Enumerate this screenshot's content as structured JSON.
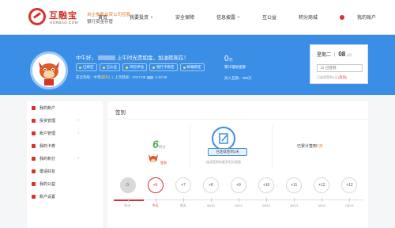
{
  "brand": {
    "name_cn": "互融宝",
    "name_en": "HURBAO.COM",
    "tagline1": "央企参股合资公司控股",
    "tagline2": "银行资金存管"
  },
  "nav": {
    "items": [
      {
        "label": "首页",
        "has_caret": false
      },
      {
        "label": "我要投资",
        "has_caret": true
      },
      {
        "label": "安全保障",
        "has_caret": false
      },
      {
        "label": "信息披露",
        "has_caret": true
      },
      {
        "label": "互公益",
        "has_caret": false
      },
      {
        "label": "积分商城",
        "has_caret": false
      },
      {
        "label": "我的账户",
        "has_caret": false
      }
    ]
  },
  "profile": {
    "greeting_prefix": "中午好，",
    "greeting_suffix": "上午时光贵如金，加油就现在！",
    "badges": [
      "已绑定",
      "已认证",
      "风险评估",
      "银行卡绑定",
      "邮箱绑定"
    ],
    "level_prefix": "安全等级：中等",
    "level_up": "[提升]",
    "last_login": "上次登录：2017-08",
    "last_login_time": "1:42:58"
  },
  "stats": {
    "amount": "0",
    "amount_unit": "元",
    "amount_label": "累计理财金额",
    "days": "加入互融：408天"
  },
  "sign_card": {
    "day_label": "星期二",
    "date_label": "08",
    "date_unit": "8月",
    "button_label": "已签到",
    "continuous_text": "已连续签到1天",
    "detail_link": "[签到]"
  },
  "sidebar": {
    "items": [
      {
        "label": "我的账户",
        "arrow": false
      },
      {
        "label": "投资管理",
        "arrow": true
      },
      {
        "label": "账户管理",
        "arrow": true
      },
      {
        "label": "我的卡券",
        "arrow": false
      },
      {
        "label": "我的积分",
        "arrow": true
      },
      {
        "label": "邀请好友",
        "arrow": false
      },
      {
        "label": "我的公益",
        "arrow": false
      },
      {
        "label": "账户设置",
        "arrow": false
      }
    ]
  },
  "sign_panel": {
    "title": "签到",
    "points": "6",
    "points_unit": "积分",
    "mascot_label": "签到",
    "status_pill": "已连续签到1天",
    "tip": "连续签到有更多积分奖励",
    "accum_prefix": "已累计签到",
    "accum_value": "1",
    "accum_unit": "天"
  },
  "calendar": [
    {
      "value": "0",
      "label": "昨天",
      "state": "done"
    },
    {
      "value": "+6",
      "label": "今天",
      "state": "today"
    },
    {
      "value": "+7",
      "label": "明天",
      "state": "future"
    },
    {
      "value": "+8",
      "label": "08/10",
      "state": "future"
    },
    {
      "value": "+9",
      "label": "08/11",
      "state": "future"
    },
    {
      "value": "+10",
      "label": "08/12",
      "state": "future"
    },
    {
      "value": "+11",
      "label": "08/13",
      "state": "future"
    },
    {
      "value": "+12",
      "label": "08/14",
      "state": "future"
    },
    {
      "value": "+12",
      "label": "08/15",
      "state": "future"
    }
  ]
}
